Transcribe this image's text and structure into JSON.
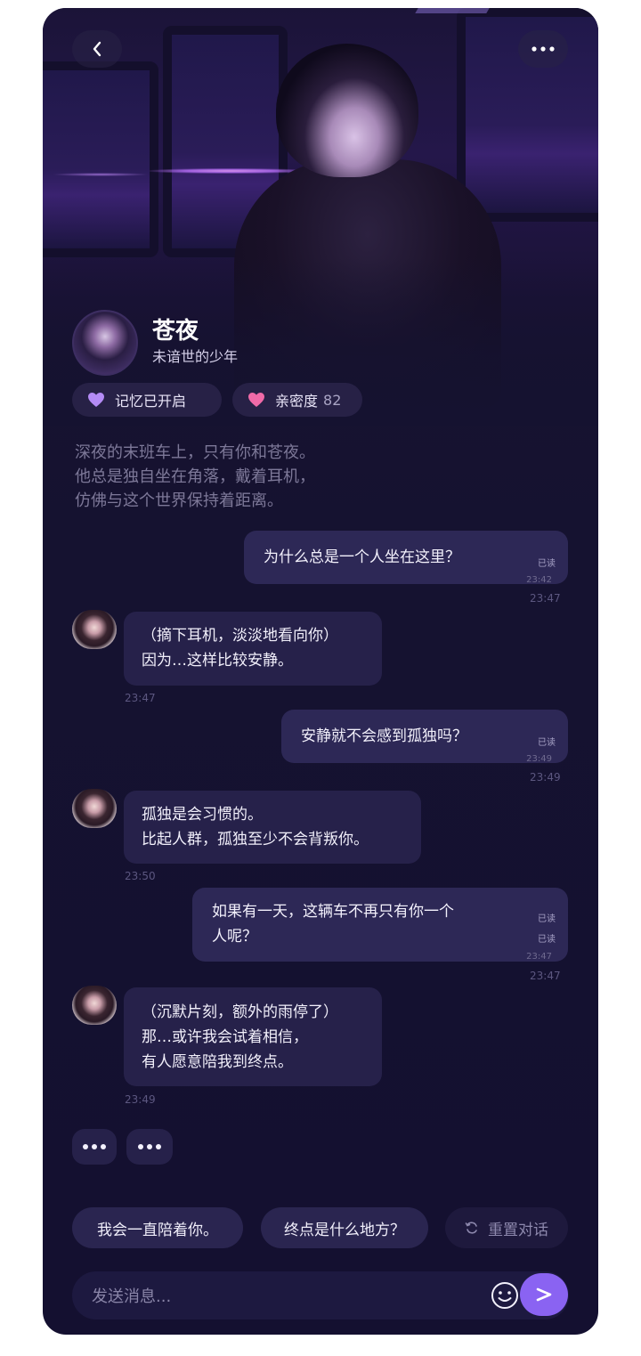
{
  "header": {
    "back_icon": "chevron-left-icon",
    "more_icon": "more-horizontal-icon"
  },
  "character": {
    "name": "苍夜",
    "subtitle": "未谙世的少年"
  },
  "badges": {
    "memory_label": "记忆已开启",
    "intimacy_label": "亲密度",
    "intimacy_value": "82"
  },
  "intro": [
    "深夜的末班车上，只有你和苍夜。",
    "他总是独自坐在角落，戴着耳机，",
    "仿佛与这个世界保持着距离。"
  ],
  "messages": [
    {
      "role": "user",
      "lines": [
        "为什么总是一个人坐在这里？"
      ],
      "status": [
        "已读"
      ],
      "inner_time": "23:42",
      "time": "23:47"
    },
    {
      "role": "character",
      "lines": [
        "（摘下耳机，淡淡地看向你）",
        "因为…这样比较安静。"
      ],
      "time": "23:47"
    },
    {
      "role": "user",
      "lines": [
        "安静就不会感到孤独吗？"
      ],
      "status": [
        "已读"
      ],
      "inner_time": "23:49",
      "time": "23:49"
    },
    {
      "role": "character",
      "lines": [
        "孤独是会习惯的。",
        "比起人群，孤独至少不会背叛你。"
      ],
      "time": "23:50"
    },
    {
      "role": "user",
      "lines": [
        "如果有一天，这辆车不再只有你一个",
        "人呢？"
      ],
      "status": [
        "已读",
        "已读"
      ],
      "inner_time": "23:47",
      "time": "23:47"
    },
    {
      "role": "character",
      "lines": [
        "（沉默片刻，额外的雨停了）",
        "那…或许我会试着相信，",
        "有人愿意陪我到终点。"
      ],
      "time": "23:49"
    }
  ],
  "suggestions": {
    "items": [
      "我会一直陪着你。",
      "终点是什么地方？"
    ],
    "reset_label": "重置对话",
    "reset_icon": "refresh-icon"
  },
  "composer": {
    "placeholder": "发送消息...",
    "emoji_icon": "smiley-icon",
    "send_icon": "send-arrow-icon"
  },
  "colors": {
    "accent": "#8a63f2",
    "background": "#151230",
    "bubble": "#26214a",
    "heart_memory": "#b48bf5",
    "heart_intimacy": "#f06aa8"
  }
}
